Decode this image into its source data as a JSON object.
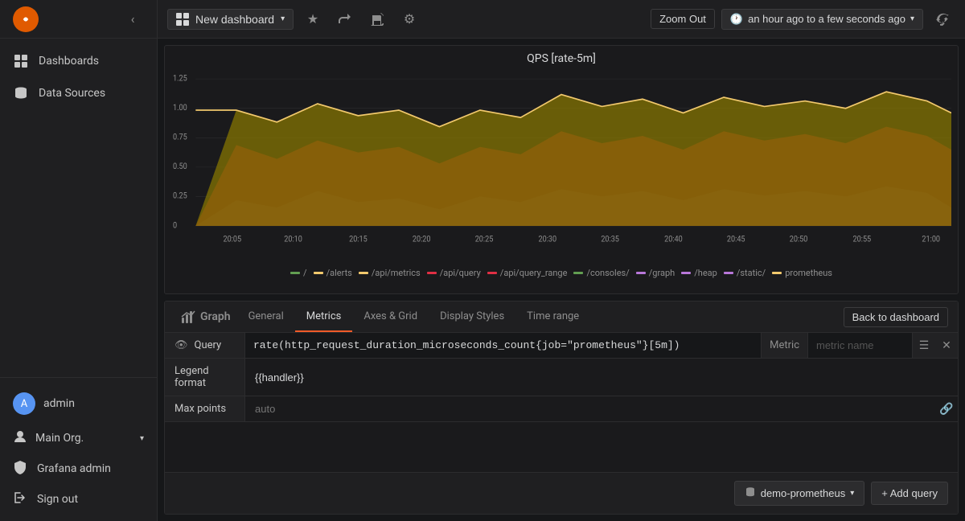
{
  "sidebar": {
    "items": [
      {
        "id": "dashboards",
        "label": "Dashboards",
        "icon": "grid"
      },
      {
        "id": "data-sources",
        "label": "Data Sources",
        "icon": "database"
      }
    ],
    "user": {
      "name": "admin",
      "initials": "A"
    },
    "org": "Main Org.",
    "grafana_admin": "Grafana admin",
    "sign_out": "Sign out"
  },
  "topbar": {
    "dashboard_title": "New dashboard",
    "zoom_out": "Zoom Out",
    "time_range": "an hour ago to a few seconds ago",
    "caret": "▾"
  },
  "chart": {
    "title": "QPS [rate-5m]",
    "y_labels": [
      "1.25",
      "1.00",
      "0.75",
      "0.50",
      "0.25",
      "0"
    ],
    "x_labels": [
      "20:05",
      "20:10",
      "20:15",
      "20:20",
      "20:25",
      "20:30",
      "20:35",
      "20:40",
      "20:45",
      "20:50",
      "20:55",
      "21:00"
    ],
    "legend": [
      {
        "label": "/",
        "color": "#629e51"
      },
      {
        "label": "/alerts",
        "color": "#f2c96d"
      },
      {
        "label": "/api/metrics",
        "color": "#f2c96d"
      },
      {
        "label": "/api/query",
        "color": "#e02f44"
      },
      {
        "label": "/api/query_range",
        "color": "#e02f44"
      },
      {
        "label": "/consoles/",
        "color": "#629e51"
      },
      {
        "label": "/graph",
        "color": "#b877d9"
      },
      {
        "label": "/heap",
        "color": "#b877d9"
      },
      {
        "label": "/static/",
        "color": "#b877d9"
      },
      {
        "label": "prometheus",
        "color": "#f2c96d"
      }
    ]
  },
  "editor": {
    "panel_icon": "📊",
    "panel_label": "Graph",
    "tabs": [
      {
        "id": "general",
        "label": "General",
        "active": false
      },
      {
        "id": "metrics",
        "label": "Metrics",
        "active": true
      },
      {
        "id": "axes-grid",
        "label": "Axes & Grid",
        "active": false
      },
      {
        "id": "display-styles",
        "label": "Display Styles",
        "active": false
      },
      {
        "id": "time-range",
        "label": "Time range",
        "active": false
      }
    ],
    "back_button": "Back to dashboard",
    "query": {
      "label": "Query",
      "value": "rate(http_request_duration_microseconds_count{job=\"prometheus\"}[5m])",
      "metric_label": "Metric",
      "metric_placeholder": "metric name"
    },
    "legend_format": {
      "label": "Legend format",
      "value": "{{handler}}"
    },
    "max_points": {
      "label": "Max points",
      "placeholder": "auto"
    },
    "datasource": {
      "label": "demo-prometheus",
      "caret": "▾"
    },
    "add_query": "+ Add query"
  }
}
